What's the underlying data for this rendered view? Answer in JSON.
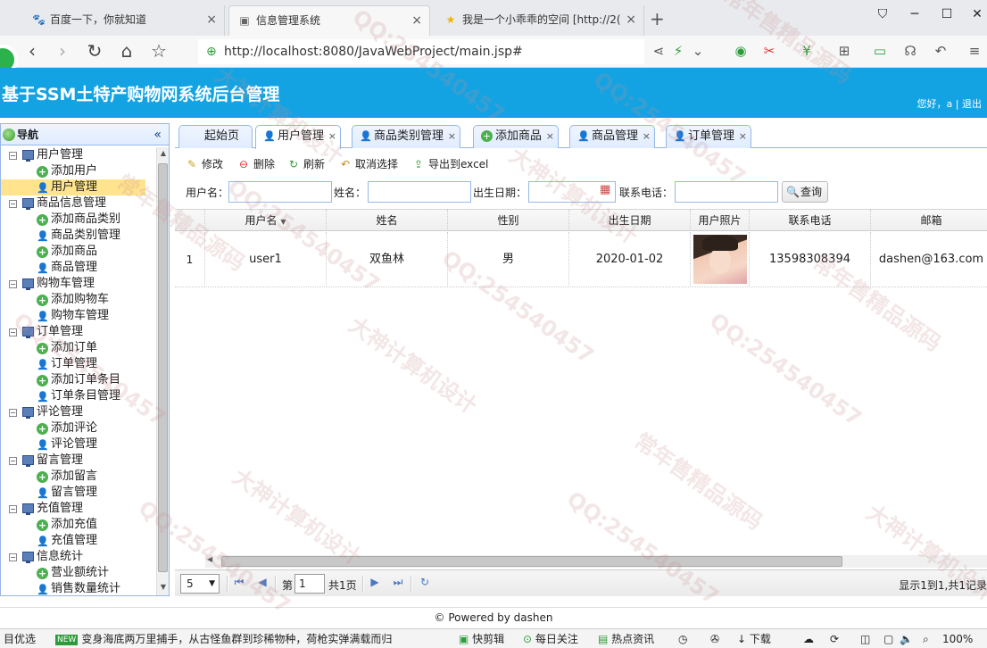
{
  "browser": {
    "tabs": [
      {
        "title": "百度一下，你就知道",
        "icon": "baidu-paw-icon"
      },
      {
        "title": "信息管理系统",
        "icon": "page-icon"
      },
      {
        "title": "我是一个小乖乖的空间 [http://2(",
        "icon": "star-icon"
      }
    ],
    "url": "http://localhost:8080/JavaWebProject/main.jsp#"
  },
  "app": {
    "title": "基于SSM土特产购物网系统后台管理",
    "greeting": "您好，a | 退出"
  },
  "sidebar": {
    "heading": "导航",
    "collapse": "«",
    "tree": [
      {
        "label": "用户管理",
        "type": "group"
      },
      {
        "label": "添加用户",
        "type": "add"
      },
      {
        "label": "用户管理",
        "type": "user",
        "selected": true
      },
      {
        "label": "商品信息管理",
        "type": "group"
      },
      {
        "label": "添加商品类别",
        "type": "add"
      },
      {
        "label": "商品类别管理",
        "type": "user"
      },
      {
        "label": "添加商品",
        "type": "add"
      },
      {
        "label": "商品管理",
        "type": "user"
      },
      {
        "label": "购物车管理",
        "type": "group"
      },
      {
        "label": "添加购物车",
        "type": "add"
      },
      {
        "label": "购物车管理",
        "type": "user"
      },
      {
        "label": "订单管理",
        "type": "group"
      },
      {
        "label": "添加订单",
        "type": "add"
      },
      {
        "label": "订单管理",
        "type": "user"
      },
      {
        "label": "添加订单条目",
        "type": "add"
      },
      {
        "label": "订单条目管理",
        "type": "user"
      },
      {
        "label": "评论管理",
        "type": "group"
      },
      {
        "label": "添加评论",
        "type": "add"
      },
      {
        "label": "评论管理",
        "type": "user"
      },
      {
        "label": "留言管理",
        "type": "group"
      },
      {
        "label": "添加留言",
        "type": "add"
      },
      {
        "label": "留言管理",
        "type": "user"
      },
      {
        "label": "充值管理",
        "type": "group"
      },
      {
        "label": "添加充值",
        "type": "add"
      },
      {
        "label": "充值管理",
        "type": "user"
      },
      {
        "label": "信息统计",
        "type": "group"
      },
      {
        "label": "营业额统计",
        "type": "add"
      },
      {
        "label": "销售数量统计",
        "type": "user"
      }
    ]
  },
  "tabs": [
    {
      "label": "起始页",
      "closable": false
    },
    {
      "label": "用户管理",
      "closable": true,
      "active": true,
      "icon": "user-icon"
    },
    {
      "label": "商品类别管理",
      "closable": true,
      "icon": "user-icon"
    },
    {
      "label": "添加商品",
      "closable": true,
      "icon": "add-icon"
    },
    {
      "label": "商品管理",
      "closable": true,
      "icon": "user-icon"
    },
    {
      "label": "订单管理",
      "closable": true,
      "icon": "user-icon"
    }
  ],
  "toolbar": {
    "edit": "修改",
    "delete": "删除",
    "refresh": "刷新",
    "cancel_select": "取消选择",
    "export": "导出到excel"
  },
  "search": {
    "username_label": "用户名：",
    "name_label": "姓名：",
    "birthday_label": "出生日期：",
    "phone_label": "联系电话：",
    "query_button": "查询",
    "username_value": "",
    "name_value": "",
    "birthday_value": "",
    "phone_value": ""
  },
  "grid": {
    "columns": [
      "用户名",
      "姓名",
      "性别",
      "出生日期",
      "用户照片",
      "联系电话",
      "邮箱"
    ],
    "rows": [
      {
        "index": "1",
        "username": "user1",
        "name": "双鱼林",
        "gender": "男",
        "birthday": "2020-01-02",
        "phone": "13598308394",
        "email": "dashen@163.com"
      }
    ]
  },
  "pager": {
    "page_size": "5",
    "page_prefix": "第",
    "page_value": "1",
    "page_total": "共1页",
    "info": "显示1到1,共1记录"
  },
  "footer": "© Powered by dashen",
  "statusbar": {
    "left": "目优选",
    "news_badge": "NEW",
    "news": "变身海底两万里捕手，从古怪鱼群到珍稀物种，荷枪实弹满载而归",
    "items": [
      "快剪辑",
      "每日关注",
      "热点资讯",
      "下载"
    ],
    "zoom": "100%"
  },
  "watermark": [
    "QQ:254540457",
    "大神计算机设计",
    "常年售精品源码"
  ]
}
